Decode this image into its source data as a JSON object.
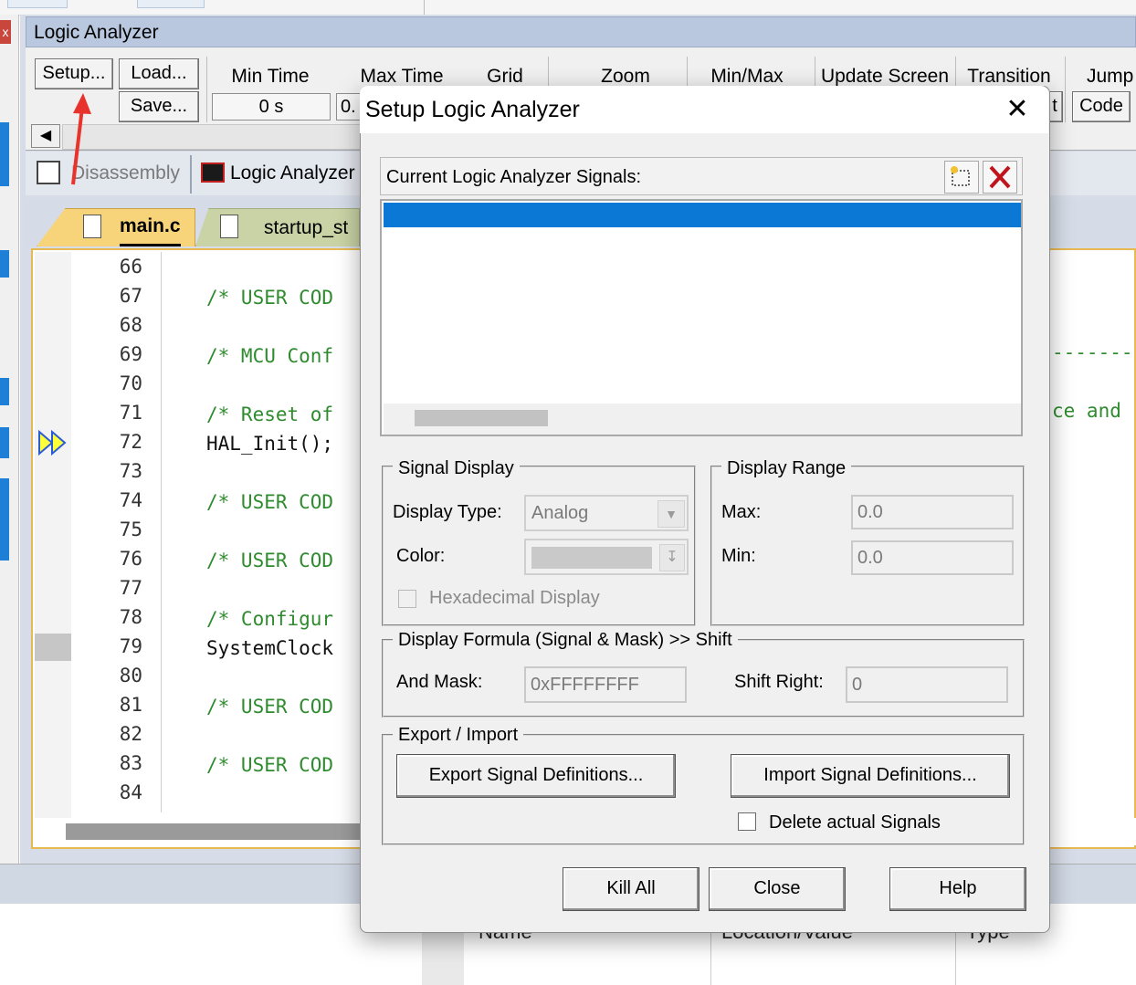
{
  "background_ide": {
    "window_title": "Logic Analyzer",
    "toolbar": {
      "setup_label": "Setup...",
      "load_label": "Load...",
      "save_label": "Save...",
      "min_time_label": "Min Time",
      "min_time_value": "0 s",
      "max_time_label": "Max Time",
      "max_time_value_partial": "0.",
      "grid_label": "Grid",
      "zoom_label": "Zoom",
      "minmax_label": "Min/Max",
      "update_screen_label": "Update Screen",
      "transition_label": "Transition",
      "transition_partial": "t",
      "jump_label": "Jump",
      "code_label": "Code"
    },
    "window_tabs": [
      {
        "label": "Disassembly"
      },
      {
        "label": "Logic Analyzer"
      }
    ],
    "file_tabs": [
      {
        "label": "main.c"
      },
      {
        "label": "startup_st"
      }
    ],
    "code_lines": [
      {
        "num": "66",
        "text": ""
      },
      {
        "num": "67",
        "text": "/* USER COD"
      },
      {
        "num": "68",
        "text": ""
      },
      {
        "num": "69",
        "text": "/* MCU Conf"
      },
      {
        "num": "70",
        "text": ""
      },
      {
        "num": "71",
        "text": "/* Reset of"
      },
      {
        "num": "72",
        "text": "HAL_Init();"
      },
      {
        "num": "73",
        "text": ""
      },
      {
        "num": "74",
        "text": "/* USER COD"
      },
      {
        "num": "75",
        "text": ""
      },
      {
        "num": "76",
        "text": "/* USER COD"
      },
      {
        "num": "77",
        "text": ""
      },
      {
        "num": "78",
        "text": "/* Configur"
      },
      {
        "num": "79",
        "text": "SystemClock"
      },
      {
        "num": "80",
        "text": ""
      },
      {
        "num": "81",
        "text": "/* USER COD"
      },
      {
        "num": "82",
        "text": ""
      },
      {
        "num": "83",
        "text": "/* USER COD"
      },
      {
        "num": "84",
        "text": ""
      }
    ],
    "code_right_fragments": {
      "line69": "-------",
      "line71": "ce and"
    },
    "bottom_headers": {
      "name": "Name",
      "location": "Location/Value",
      "type": "Type"
    }
  },
  "dialog": {
    "title": "Setup Logic Analyzer",
    "signals_header": "Current Logic Analyzer Signals:",
    "signal_display": {
      "legend": "Signal Display",
      "display_type_label": "Display Type:",
      "display_type_value": "Analog",
      "color_label": "Color:",
      "hex_label": "Hexadecimal Display"
    },
    "display_range": {
      "legend": "Display Range",
      "max_label": "Max:",
      "max_value": "0.0",
      "min_label": "Min:",
      "min_value": "0.0"
    },
    "formula": {
      "legend": "Display Formula (Signal & Mask) >> Shift",
      "and_mask_label": "And Mask:",
      "and_mask_value": "0xFFFFFFFF",
      "shift_right_label": "Shift Right:",
      "shift_right_value": "0"
    },
    "export_import": {
      "legend": "Export / Import",
      "export_button": "Export Signal Definitions...",
      "import_button": "Import Signal Definitions...",
      "delete_label": "Delete actual Signals"
    },
    "buttons": {
      "kill_all": "Kill All",
      "close": "Close",
      "help": "Help"
    }
  },
  "colors": {
    "selection_blue": "#0a78d4",
    "annotation_arrow": "#e8322c",
    "comment_green": "#2e8b2e",
    "tab_active": "#f7d37a"
  }
}
